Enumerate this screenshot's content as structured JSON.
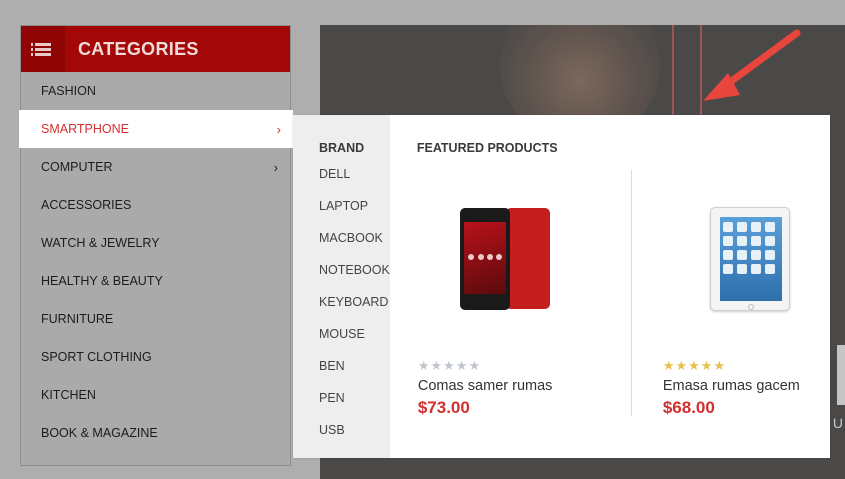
{
  "categories": {
    "title": "CATEGORIES",
    "items": [
      {
        "label": "FASHION",
        "has_submenu": false
      },
      {
        "label": "SMARTPHONE",
        "has_submenu": true
      },
      {
        "label": "COMPUTER",
        "has_submenu": true
      },
      {
        "label": "ACCESSORIES",
        "has_submenu": false
      },
      {
        "label": "WATCH & JEWELRY",
        "has_submenu": false
      },
      {
        "label": "HEALTHY & BEAUTY",
        "has_submenu": false
      },
      {
        "label": "FURNITURE",
        "has_submenu": false
      },
      {
        "label": "SPORT CLOTHING",
        "has_submenu": false
      },
      {
        "label": "KITCHEN",
        "has_submenu": false
      },
      {
        "label": "BOOK & MAGAZINE",
        "has_submenu": false
      }
    ],
    "chevron": "›"
  },
  "dropdown": {
    "brand_heading": "BRAND",
    "brands": [
      "DELL",
      "LAPTOP",
      "MACBOOK",
      "NOTEBOOK",
      "KEYBOARD",
      "MOUSE",
      "BEN",
      "PEN",
      "USB"
    ],
    "featured_heading": "FEATURED PRODUCTS",
    "products": [
      {
        "name": "Comas samer rumas",
        "price": "$73.00",
        "rating": 0,
        "max_rating": 5,
        "image": "red-smartphone"
      },
      {
        "name": "Emasa rumas gacem",
        "price": "$68.00",
        "rating": 5,
        "max_rating": 5,
        "image": "white-tablet"
      }
    ]
  },
  "banner": {
    "side_letter": "U"
  },
  "colors": {
    "accent": "#a30707",
    "price": "#d32f2f",
    "star_gold": "#e6c14f",
    "star_gray": "#c2c6cf"
  }
}
